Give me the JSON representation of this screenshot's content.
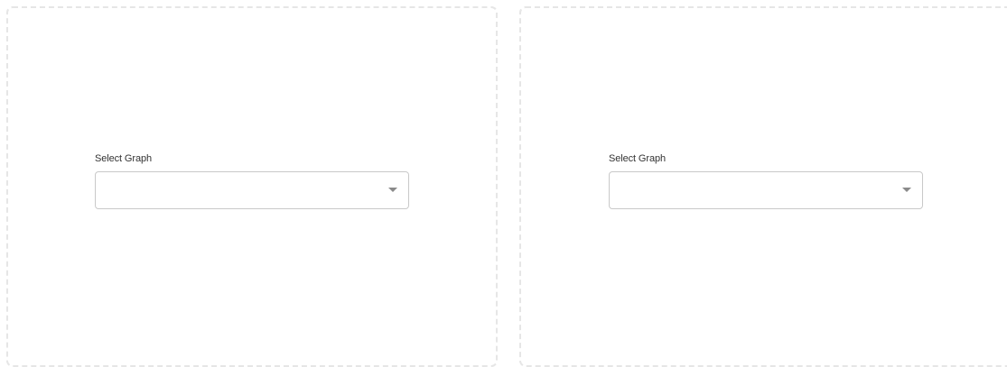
{
  "panels": [
    {
      "field_label": "Select Graph",
      "selected_value": "",
      "dropdown_icon": "caret-down-icon"
    },
    {
      "field_label": "Select Graph",
      "selected_value": "",
      "dropdown_icon": "caret-down-icon"
    }
  ],
  "colors": {
    "panel_border": "#e6e6e6",
    "select_border": "#c9c9c9",
    "caret": "#8a8a8a",
    "label_text": "#333333"
  }
}
